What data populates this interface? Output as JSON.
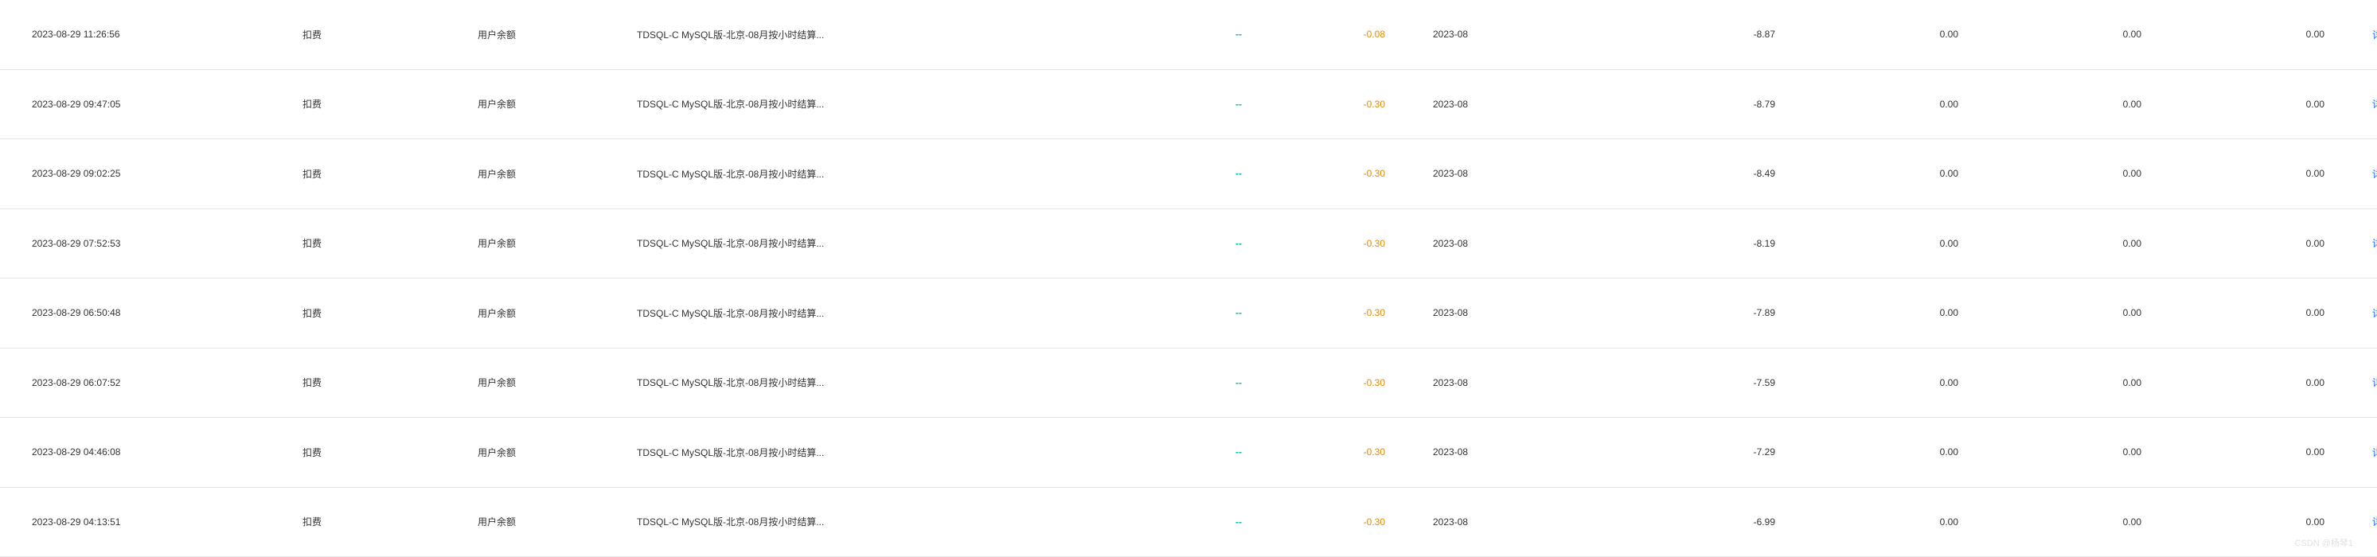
{
  "rows": [
    {
      "time": "2023-08-29 11:26:56",
      "type": "扣费",
      "source": "用户余额",
      "description": "TDSQL-C MySQL版-北京-08月按小时结算...",
      "col_dash": "--",
      "amount": "-0.08",
      "period": "2023-08",
      "balance": "-8.87",
      "n1": "0.00",
      "n2": "0.00",
      "n3": "0.00",
      "action_label": "详情"
    },
    {
      "time": "2023-08-29 09:47:05",
      "type": "扣费",
      "source": "用户余额",
      "description": "TDSQL-C MySQL版-北京-08月按小时结算...",
      "col_dash": "--",
      "amount": "-0.30",
      "period": "2023-08",
      "balance": "-8.79",
      "n1": "0.00",
      "n2": "0.00",
      "n3": "0.00",
      "action_label": "详情"
    },
    {
      "time": "2023-08-29 09:02:25",
      "type": "扣费",
      "source": "用户余额",
      "description": "TDSQL-C MySQL版-北京-08月按小时结算...",
      "col_dash": "--",
      "amount": "-0.30",
      "period": "2023-08",
      "balance": "-8.49",
      "n1": "0.00",
      "n2": "0.00",
      "n3": "0.00",
      "action_label": "详情"
    },
    {
      "time": "2023-08-29 07:52:53",
      "type": "扣费",
      "source": "用户余额",
      "description": "TDSQL-C MySQL版-北京-08月按小时结算...",
      "col_dash": "--",
      "amount": "-0.30",
      "period": "2023-08",
      "balance": "-8.19",
      "n1": "0.00",
      "n2": "0.00",
      "n3": "0.00",
      "action_label": "详情"
    },
    {
      "time": "2023-08-29 06:50:48",
      "type": "扣费",
      "source": "用户余额",
      "description": "TDSQL-C MySQL版-北京-08月按小时结算...",
      "col_dash": "--",
      "amount": "-0.30",
      "period": "2023-08",
      "balance": "-7.89",
      "n1": "0.00",
      "n2": "0.00",
      "n3": "0.00",
      "action_label": "详情"
    },
    {
      "time": "2023-08-29 06:07:52",
      "type": "扣费",
      "source": "用户余额",
      "description": "TDSQL-C MySQL版-北京-08月按小时结算...",
      "col_dash": "--",
      "amount": "-0.30",
      "period": "2023-08",
      "balance": "-7.59",
      "n1": "0.00",
      "n2": "0.00",
      "n3": "0.00",
      "action_label": "详情"
    },
    {
      "time": "2023-08-29 04:46:08",
      "type": "扣费",
      "source": "用户余额",
      "description": "TDSQL-C MySQL版-北京-08月按小时结算...",
      "col_dash": "--",
      "amount": "-0.30",
      "period": "2023-08",
      "balance": "-7.29",
      "n1": "0.00",
      "n2": "0.00",
      "n3": "0.00",
      "action_label": "详情"
    },
    {
      "time": "2023-08-29 04:13:51",
      "type": "扣费",
      "source": "用户余额",
      "description": "TDSQL-C MySQL版-北京-08月按小时结算...",
      "col_dash": "--",
      "amount": "-0.30",
      "period": "2023-08",
      "balance": "-6.99",
      "n1": "0.00",
      "n2": "0.00",
      "n3": "0.00",
      "action_label": "详情"
    }
  ],
  "watermark": "CSDN @杨琴1"
}
